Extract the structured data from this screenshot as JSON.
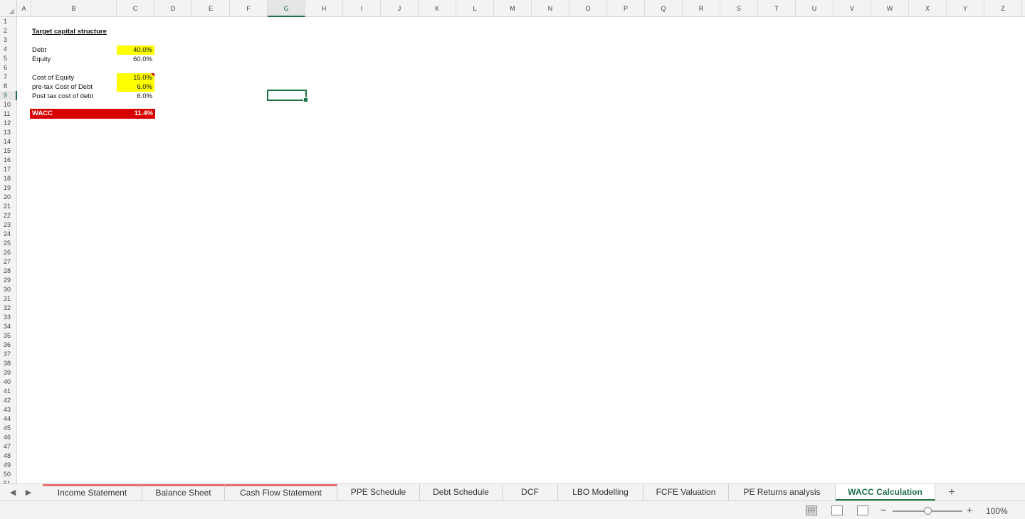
{
  "columns": [
    "A",
    "B",
    "C",
    "D",
    "E",
    "F",
    "G",
    "H",
    "I",
    "J",
    "K",
    "L",
    "M",
    "N",
    "O",
    "P",
    "Q",
    "R",
    "S",
    "T",
    "U",
    "V",
    "W",
    "X",
    "Y",
    "Z"
  ],
  "selected_column": "G",
  "rows": [
    "1",
    "2",
    "3",
    "4",
    "5",
    "6",
    "7",
    "8",
    "9",
    "10",
    "11",
    "12",
    "13",
    "14",
    "15",
    "16",
    "17",
    "18",
    "19",
    "20",
    "21",
    "22",
    "23",
    "24",
    "25",
    "26",
    "27",
    "28",
    "29",
    "30",
    "31",
    "32",
    "33",
    "34",
    "35",
    "36",
    "37",
    "38",
    "39",
    "40",
    "41",
    "42",
    "43",
    "44",
    "45",
    "46",
    "47",
    "48",
    "49",
    "50",
    "51"
  ],
  "selected_row": "9",
  "cells": {
    "title": "Target capital structure",
    "debt_label": "Debt",
    "debt_value": "40.0%",
    "equity_label": "Equity",
    "equity_value": "60.0%",
    "cost_equity_label": "Cost of Equity",
    "cost_equity_value": "15.0%",
    "pretax_debt_label": "pre-tax Cost of Debt",
    "pretax_debt_value": "6.0%",
    "posttax_debt_label": "Post tax cost of debt",
    "posttax_debt_value": "6.0%",
    "wacc_label": "WACC",
    "wacc_value": "11.4%"
  },
  "tabs": [
    {
      "label": "Income Statement",
      "color": "#e57373"
    },
    {
      "label": "Balance Sheet",
      "color": "#e57373"
    },
    {
      "label": "Cash Flow Statement",
      "color": "#e57373"
    },
    {
      "label": "PPE Schedule"
    },
    {
      "label": "Debt Schedule"
    },
    {
      "label": "DCF"
    },
    {
      "label": "LBO Modelling"
    },
    {
      "label": "FCFE Valuation"
    },
    {
      "label": "PE Returns analysis"
    },
    {
      "label": "WACC Calculation",
      "active": true
    }
  ],
  "add_tab_icon": "+",
  "nav_prev_icon": "◀",
  "nav_next_icon": "▶",
  "zoom": {
    "minus": "−",
    "plus": "+",
    "level": "100%",
    "fraction": 0.5
  },
  "colors": {
    "accent": "#1e7145",
    "wacc_fill": "#d80000",
    "input_fill": "#ffff00"
  }
}
